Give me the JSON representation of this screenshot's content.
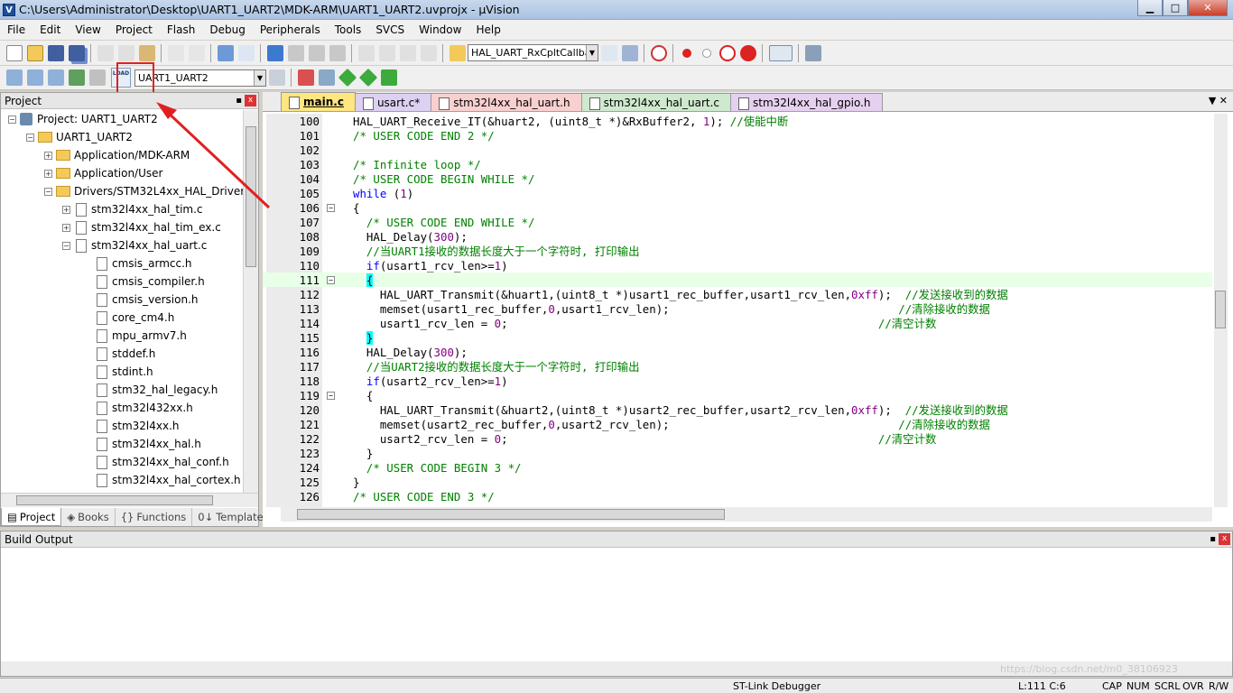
{
  "window": {
    "app_icon": "keil-uvision-icon",
    "title": "C:\\Users\\Administrator\\Desktop\\UART1_UART2\\MDK-ARM\\UART1_UART2.uvprojx - µVision",
    "minimize": "▁",
    "maximize": "□",
    "close": "✕"
  },
  "menu": [
    "File",
    "Edit",
    "View",
    "Project",
    "Flash",
    "Debug",
    "Peripherals",
    "Tools",
    "SVCS",
    "Window",
    "Help"
  ],
  "toolbar1": {
    "function_combo": "HAL_UART_RxCpltCallbac"
  },
  "toolbar2": {
    "load_label": "LOAD",
    "target_combo": "UART1_UART2"
  },
  "project_panel": {
    "title": "Project",
    "pin": "📌",
    "close": "x",
    "tree": [
      {
        "label": "Project: UART1_UART2",
        "level": 0,
        "kind": "project",
        "expander": "−"
      },
      {
        "label": "UART1_UART2",
        "level": 1,
        "kind": "folder",
        "expander": "−"
      },
      {
        "label": "Application/MDK-ARM",
        "level": 2,
        "kind": "folder",
        "expander": "+"
      },
      {
        "label": "Application/User",
        "level": 2,
        "kind": "folder",
        "expander": "+"
      },
      {
        "label": "Drivers/STM32L4xx_HAL_Driver",
        "level": 2,
        "kind": "folder",
        "expander": "−"
      },
      {
        "label": "stm32l4xx_hal_tim.c",
        "level": 3,
        "kind": "file",
        "expander": "+"
      },
      {
        "label": "stm32l4xx_hal_tim_ex.c",
        "level": 3,
        "kind": "file",
        "expander": "+"
      },
      {
        "label": "stm32l4xx_hal_uart.c",
        "level": 3,
        "kind": "file",
        "expander": "−"
      },
      {
        "label": "cmsis_armcc.h",
        "level": 4,
        "kind": "file",
        "expander": ""
      },
      {
        "label": "cmsis_compiler.h",
        "level": 4,
        "kind": "file",
        "expander": ""
      },
      {
        "label": "cmsis_version.h",
        "level": 4,
        "kind": "file",
        "expander": ""
      },
      {
        "label": "core_cm4.h",
        "level": 4,
        "kind": "file",
        "expander": ""
      },
      {
        "label": "mpu_armv7.h",
        "level": 4,
        "kind": "file",
        "expander": ""
      },
      {
        "label": "stddef.h",
        "level": 4,
        "kind": "file",
        "expander": ""
      },
      {
        "label": "stdint.h",
        "level": 4,
        "kind": "file",
        "expander": ""
      },
      {
        "label": "stm32_hal_legacy.h",
        "level": 4,
        "kind": "file",
        "expander": ""
      },
      {
        "label": "stm32l432xx.h",
        "level": 4,
        "kind": "file",
        "expander": ""
      },
      {
        "label": "stm32l4xx.h",
        "level": 4,
        "kind": "file",
        "expander": ""
      },
      {
        "label": "stm32l4xx_hal.h",
        "level": 4,
        "kind": "file",
        "expander": ""
      },
      {
        "label": "stm32l4xx_hal_conf.h",
        "level": 4,
        "kind": "file",
        "expander": ""
      },
      {
        "label": "stm32l4xx_hal_cortex.h",
        "level": 4,
        "kind": "file",
        "expander": ""
      }
    ],
    "bottom_tabs": [
      {
        "label": "Project",
        "icon": "▤",
        "active": true
      },
      {
        "label": "Books",
        "icon": "◈",
        "active": false
      },
      {
        "label": "Functions",
        "icon": "{}",
        "active": false
      },
      {
        "label": "Templates",
        "icon": "0↓",
        "active": false
      }
    ]
  },
  "editor": {
    "tabs": [
      {
        "label": "main.c",
        "color": "#ffe680",
        "active": true
      },
      {
        "label": "usart.c*",
        "color": "#ddd0f2",
        "active": false
      },
      {
        "label": "stm32l4xx_hal_uart.h",
        "color": "#f9d0d0",
        "active": false
      },
      {
        "label": "stm32l4xx_hal_uart.c",
        "color": "#cfe9cf",
        "active": false
      },
      {
        "label": "stm32l4xx_hal_gpio.h",
        "color": "#e6d0f0",
        "active": false
      }
    ],
    "tab_controls": "▼  ✕",
    "current_line": 111,
    "lines": [
      {
        "n": "100",
        "fold": "",
        "segs": [
          [
            "",
            "HAL_UART_Receive_IT(&huart2, (uint8_t *)&RxBuffer2, "
          ],
          [
            "nm",
            "1"
          ],
          [
            "",
            "); "
          ],
          [
            "cm",
            "//使能中断"
          ]
        ]
      },
      {
        "n": "101",
        "fold": "",
        "segs": [
          [
            "cm",
            "/* USER CODE END 2 */"
          ]
        ]
      },
      {
        "n": "102",
        "fold": "",
        "segs": []
      },
      {
        "n": "103",
        "fold": "",
        "segs": [
          [
            "cm",
            "/* Infinite loop */"
          ]
        ]
      },
      {
        "n": "104",
        "fold": "",
        "segs": [
          [
            "cm",
            "/* USER CODE BEGIN WHILE */"
          ]
        ]
      },
      {
        "n": "105",
        "fold": "",
        "segs": [
          [
            "kw",
            "while"
          ],
          [
            "",
            " ("
          ],
          [
            "nm",
            "1"
          ],
          [
            "",
            ")"
          ]
        ]
      },
      {
        "n": "106",
        "fold": "−",
        "segs": [
          [
            "",
            "{"
          ]
        ]
      },
      {
        "n": "107",
        "fold": "",
        "segs": [
          [
            "",
            "  "
          ],
          [
            "cm",
            "/* USER CODE END WHILE */"
          ]
        ]
      },
      {
        "n": "108",
        "fold": "",
        "segs": [
          [
            "",
            "  HAL_Delay("
          ],
          [
            "nm",
            "300"
          ],
          [
            "",
            ");"
          ]
        ]
      },
      {
        "n": "109",
        "fold": "",
        "segs": [
          [
            "",
            "  "
          ],
          [
            "cm",
            "//当UART1接收的数据长度大于一个字符时, 打印输出"
          ]
        ]
      },
      {
        "n": "110",
        "fold": "",
        "segs": [
          [
            "",
            "  "
          ],
          [
            "kw",
            "if"
          ],
          [
            "",
            "(usart1_rcv_len>="
          ],
          [
            "nm",
            "1"
          ],
          [
            "",
            ")"
          ]
        ]
      },
      {
        "n": "111",
        "fold": "−",
        "segs": [
          [
            "",
            "  "
          ],
          [
            "br",
            "{"
          ]
        ]
      },
      {
        "n": "112",
        "fold": "",
        "segs": [
          [
            "",
            "    HAL_UART_Transmit(&huart1,(uint8_t *)usart1_rec_buffer,usart1_rcv_len,"
          ],
          [
            "nm",
            "0xff"
          ],
          [
            "",
            ");  "
          ],
          [
            "cm",
            "//发送接收到的数据"
          ]
        ]
      },
      {
        "n": "113",
        "fold": "",
        "segs": [
          [
            "",
            "    memset(usart1_rec_buffer,"
          ],
          [
            "nm",
            "0"
          ],
          [
            "",
            ",usart1_rcv_len);                                  "
          ],
          [
            "cm",
            "//清除接收的数据"
          ]
        ]
      },
      {
        "n": "114",
        "fold": "",
        "segs": [
          [
            "",
            "    usart1_rcv_len = "
          ],
          [
            "nm",
            "0"
          ],
          [
            "",
            ";                                                       "
          ],
          [
            "cm",
            "//清空计数"
          ]
        ]
      },
      {
        "n": "115",
        "fold": "",
        "segs": [
          [
            "",
            "  "
          ],
          [
            "br",
            "}"
          ]
        ]
      },
      {
        "n": "116",
        "fold": "",
        "segs": [
          [
            "",
            "  HAL_Delay("
          ],
          [
            "nm",
            "300"
          ],
          [
            "",
            ");"
          ]
        ]
      },
      {
        "n": "117",
        "fold": "",
        "segs": [
          [
            "",
            "  "
          ],
          [
            "cm",
            "//当UART2接收的数据长度大于一个字符时, 打印输出"
          ]
        ]
      },
      {
        "n": "118",
        "fold": "",
        "segs": [
          [
            "",
            "  "
          ],
          [
            "kw",
            "if"
          ],
          [
            "",
            "(usart2_rcv_len>="
          ],
          [
            "nm",
            "1"
          ],
          [
            "",
            ")"
          ]
        ]
      },
      {
        "n": "119",
        "fold": "−",
        "segs": [
          [
            "",
            "  {"
          ]
        ]
      },
      {
        "n": "120",
        "fold": "",
        "segs": [
          [
            "",
            "    HAL_UART_Transmit(&huart2,(uint8_t *)usart2_rec_buffer,usart2_rcv_len,"
          ],
          [
            "nm",
            "0xff"
          ],
          [
            "",
            ");  "
          ],
          [
            "cm",
            "//发送接收到的数据"
          ]
        ]
      },
      {
        "n": "121",
        "fold": "",
        "segs": [
          [
            "",
            "    memset(usart2_rec_buffer,"
          ],
          [
            "nm",
            "0"
          ],
          [
            "",
            ",usart2_rcv_len);                                  "
          ],
          [
            "cm",
            "//清除接收的数据"
          ]
        ]
      },
      {
        "n": "122",
        "fold": "",
        "segs": [
          [
            "",
            "    usart2_rcv_len = "
          ],
          [
            "nm",
            "0"
          ],
          [
            "",
            ";                                                       "
          ],
          [
            "cm",
            "//清空计数"
          ]
        ]
      },
      {
        "n": "123",
        "fold": "",
        "segs": [
          [
            "",
            "  }"
          ]
        ]
      },
      {
        "n": "124",
        "fold": "",
        "segs": [
          [
            "",
            "  "
          ],
          [
            "cm",
            "/* USER CODE BEGIN 3 */"
          ]
        ]
      },
      {
        "n": "125",
        "fold": "",
        "segs": [
          [
            "",
            "}"
          ]
        ]
      },
      {
        "n": "126",
        "fold": "",
        "segs": [
          [
            "cm",
            "/* USER CODE END 3 */"
          ]
        ]
      }
    ]
  },
  "build_output": {
    "title": "Build Output",
    "pin": "📌",
    "close": "x"
  },
  "status_bar": {
    "debugger": "ST-Link Debugger",
    "position": "L:111 C:6",
    "caps": "CAP",
    "num": "NUM",
    "scrl": "SCRL",
    "ovr": "OVR",
    "rw": "R/W"
  },
  "watermark": "https://blog.csdn.net/m0_38106923",
  "colors": {
    "annotation_red": "#e02020",
    "keyword": "#0000ff",
    "comment": "#008000",
    "number": "#800080",
    "current_line": "#e8ffe8"
  }
}
